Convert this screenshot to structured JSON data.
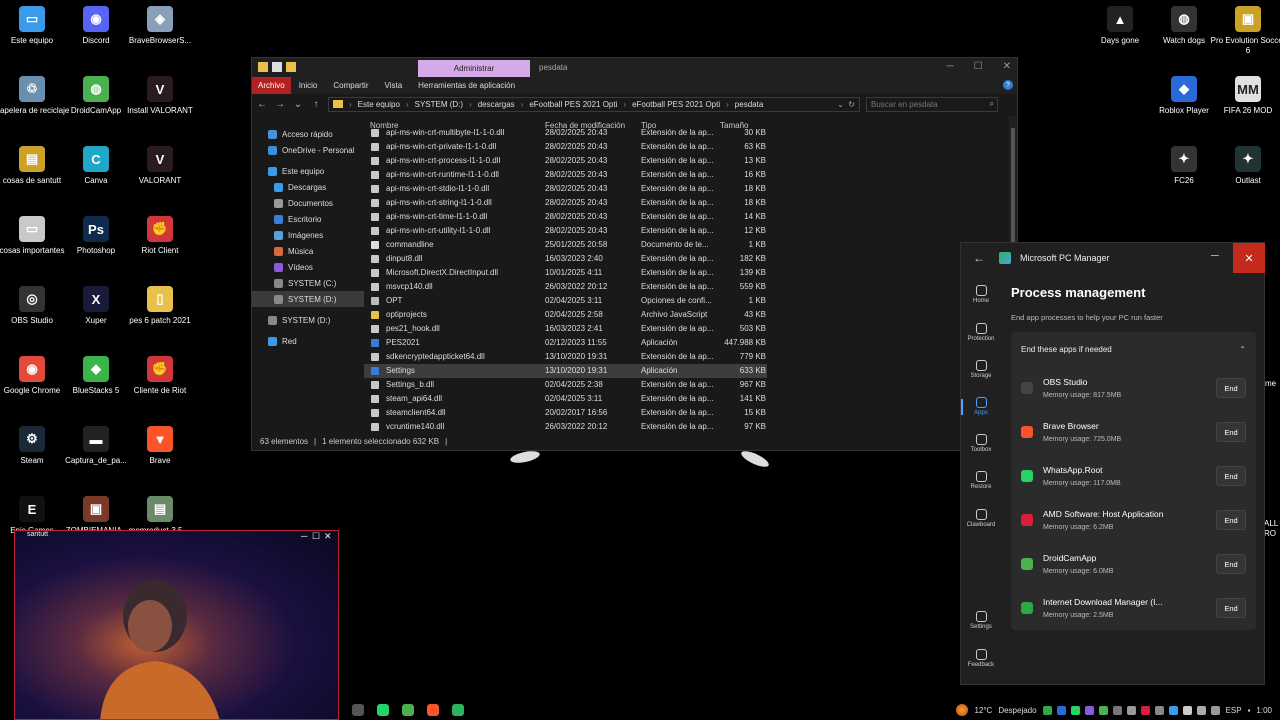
{
  "desktop_left": [
    {
      "label": "Este equipo",
      "color": "#3c9be8",
      "glyph": "▭"
    },
    {
      "label": "Discord",
      "color": "#5865f2",
      "glyph": "◉"
    },
    {
      "label": "BraveBrowserS...",
      "color": "#8aa0b8",
      "glyph": "◈"
    },
    {
      "label": "Papelera de reciclaje",
      "color": "#6a8fb0",
      "glyph": "♲"
    },
    {
      "label": "DroidCamApp",
      "color": "#4caf50",
      "glyph": "◍"
    },
    {
      "label": "Install VALORANT",
      "color": "#2a1a22",
      "glyph": "V"
    },
    {
      "label": "cosas de santutt",
      "color": "#c9a227",
      "glyph": "▤"
    },
    {
      "label": "Canva",
      "color": "#20a7c7",
      "glyph": "C"
    },
    {
      "label": "VALORANT",
      "color": "#2a1a22",
      "glyph": "V"
    },
    {
      "label": "cosas importantes",
      "color": "#c9c9c9",
      "glyph": "▭"
    },
    {
      "label": "Photoshop",
      "color": "#0f2a4a",
      "glyph": "Ps"
    },
    {
      "label": "Riot Client",
      "color": "#d13639",
      "glyph": "✊"
    },
    {
      "label": "OBS Studio",
      "color": "#333",
      "glyph": "◎"
    },
    {
      "label": "Xuper",
      "color": "#1a1a3a",
      "glyph": "X"
    },
    {
      "label": "pes 6 patch 2021",
      "color": "#e8c04a",
      "glyph": "▯"
    },
    {
      "label": "Google Chrome",
      "color": "#e24a3a",
      "glyph": "◉"
    },
    {
      "label": "BlueStacks 5",
      "color": "#3ab54a",
      "glyph": "◆"
    },
    {
      "label": "Cliente de Riot",
      "color": "#d13639",
      "glyph": "✊"
    },
    {
      "label": "Steam",
      "color": "#1b2838",
      "glyph": "⚙"
    },
    {
      "label": "Captura_de_pa...",
      "color": "#222",
      "glyph": "▬"
    },
    {
      "label": "Brave",
      "color": "#fb542b",
      "glyph": "▼"
    },
    {
      "label": "Epic Games",
      "color": "#111",
      "glyph": "E"
    },
    {
      "label": "ZOMBIEMANIA -",
      "color": "#7a3a2a",
      "glyph": "▣"
    },
    {
      "label": "memreduct-3.5....",
      "color": "#6a8a6a",
      "glyph": "▤"
    }
  ],
  "desktop_right": [
    {
      "label": "Days gone",
      "color": "#222",
      "glyph": "▲"
    },
    {
      "label": "Watch dogs",
      "color": "#333",
      "glyph": "◍"
    },
    {
      "label": "Pro Evolution Soccer 6",
      "color": "#c9a227",
      "glyph": "▣"
    },
    {
      "label": "Roblox Player",
      "color": "#2a6ad8",
      "glyph": "◆"
    },
    {
      "label": "FIFA 26 MOD",
      "color": "#e0e0e0",
      "glyph": "MM"
    },
    {
      "label": "FC26",
      "color": "#333",
      "glyph": "✦"
    },
    {
      "label": "Outlast",
      "color": "#233",
      "glyph": "✦"
    }
  ],
  "explorer": {
    "admin_tab": "Administrar",
    "folder_name": "pesdata",
    "ribbon": {
      "file": "Archivo",
      "tabs": [
        "Inicio",
        "Compartir",
        "Vista",
        "Herramientas de aplicación"
      ]
    },
    "breadcrumb": [
      "Este equipo",
      "SYSTEM (D:)",
      "descargas",
      "eFootball PES 2021 Opti",
      "eFootball PES 2021 Opti",
      "pesdata"
    ],
    "search_placeholder": "Buscar en pesdata",
    "nav": [
      {
        "label": "Acceso rápido",
        "color": "#4a90d9",
        "indent": 0
      },
      {
        "label": "OneDrive - Personal",
        "color": "#3a8fd8",
        "indent": 0
      },
      {
        "label": "Este equipo",
        "color": "#3c9be8",
        "indent": 0
      },
      {
        "label": "Descargas",
        "color": "#3c9be8",
        "indent": 1
      },
      {
        "label": "Documentos",
        "color": "#999",
        "indent": 1
      },
      {
        "label": "Escritorio",
        "color": "#3c7bd8",
        "indent": 1
      },
      {
        "label": "Imágenes",
        "color": "#5aa0d8",
        "indent": 1
      },
      {
        "label": "Música",
        "color": "#d86a3a",
        "indent": 1
      },
      {
        "label": "Vídeos",
        "color": "#8a5ad8",
        "indent": 1
      },
      {
        "label": "SYSTEM (C:)",
        "color": "#888",
        "indent": 1
      },
      {
        "label": "SYSTEM (D:)",
        "color": "#888",
        "indent": 1,
        "selected": true
      },
      {
        "label": "SYSTEM (D:)",
        "color": "#888",
        "indent": 0
      },
      {
        "label": "Red",
        "color": "#3c9be8",
        "indent": 0
      }
    ],
    "columns": {
      "name": "Nombre",
      "date": "Fecha de modificación",
      "type": "Tipo",
      "size": "Tamaño"
    },
    "files": [
      {
        "name": "api-ms-win-crt-multibyte-l1-1-0.dll",
        "date": "28/02/2025 20:43",
        "type": "Extensión de la ap...",
        "size": "30 KB"
      },
      {
        "name": "api-ms-win-crt-private-l1-1-0.dll",
        "date": "28/02/2025 20:43",
        "type": "Extensión de la ap...",
        "size": "63 KB"
      },
      {
        "name": "api-ms-win-crt-process-l1-1-0.dll",
        "date": "28/02/2025 20:43",
        "type": "Extensión de la ap...",
        "size": "13 KB"
      },
      {
        "name": "api-ms-win-crt-runtime-l1-1-0.dll",
        "date": "28/02/2025 20:43",
        "type": "Extensión de la ap...",
        "size": "16 KB"
      },
      {
        "name": "api-ms-win-crt-stdio-l1-1-0.dll",
        "date": "28/02/2025 20:43",
        "type": "Extensión de la ap...",
        "size": "18 KB"
      },
      {
        "name": "api-ms-win-crt-string-l1-1-0.dll",
        "date": "28/02/2025 20:43",
        "type": "Extensión de la ap...",
        "size": "18 KB"
      },
      {
        "name": "api-ms-win-crt-time-l1-1-0.dll",
        "date": "28/02/2025 20:43",
        "type": "Extensión de la ap...",
        "size": "14 KB"
      },
      {
        "name": "api-ms-win-crt-utility-l1-1-0.dll",
        "date": "28/02/2025 20:43",
        "type": "Extensión de la ap...",
        "size": "12 KB"
      },
      {
        "name": "commandline",
        "date": "25/01/2025 20:58",
        "type": "Documento de te...",
        "size": "1 KB"
      },
      {
        "name": "dinput8.dll",
        "date": "16/03/2023 2:40",
        "type": "Extensión de la ap...",
        "size": "182 KB"
      },
      {
        "name": "Microsoft.DirectX.DirectInput.dll",
        "date": "10/01/2025 4:11",
        "type": "Extensión de la ap...",
        "size": "139 KB"
      },
      {
        "name": "msvcp140.dll",
        "date": "26/03/2022 20:12",
        "type": "Extensión de la ap...",
        "size": "559 KB"
      },
      {
        "name": "OPT",
        "date": "02/04/2025 3:11",
        "type": "Opciones de confi...",
        "size": "1 KB"
      },
      {
        "name": "optiprojects",
        "date": "02/04/2025 2:58",
        "type": "Archivo JavaScript",
        "size": "43 KB"
      },
      {
        "name": "pes21_hook.dll",
        "date": "16/03/2023 2:41",
        "type": "Extensión de la ap...",
        "size": "503 KB"
      },
      {
        "name": "PES2021",
        "date": "02/12/2023 11:55",
        "type": "Aplicación",
        "size": "447.988 KB"
      },
      {
        "name": "sdkencryptedappticket64.dll",
        "date": "13/10/2020 19:31",
        "type": "Extensión de la ap...",
        "size": "779 KB"
      },
      {
        "name": "Settings",
        "date": "13/10/2020 19:31",
        "type": "Aplicación",
        "size": "633 KB",
        "selected": true
      },
      {
        "name": "Settings_b.dll",
        "date": "02/04/2025 2:38",
        "type": "Extensión de la ap...",
        "size": "967 KB"
      },
      {
        "name": "steam_api64.dll",
        "date": "02/04/2025 3:11",
        "type": "Extensión de la ap...",
        "size": "141 KB"
      },
      {
        "name": "steamclient64.dll",
        "date": "20/02/2017 16:56",
        "type": "Extensión de la ap...",
        "size": "15 KB"
      },
      {
        "name": "vcruntime140.dll",
        "date": "26/03/2022 20:12",
        "type": "Extensión de la ap...",
        "size": "97 KB"
      }
    ],
    "status": {
      "count": "63 elementos",
      "selected": "1 elemento seleccionado  632 KB"
    }
  },
  "pcmanager": {
    "title": "Microsoft PC Manager",
    "heading": "Process management",
    "subtitle": "End app processes to help your PC run faster",
    "section": "End these apps if needed",
    "end_label": "End",
    "sidebar": [
      {
        "label": "Home",
        "active": false
      },
      {
        "label": "Protection",
        "active": false
      },
      {
        "label": "Storage",
        "active": false
      },
      {
        "label": "Apps",
        "active": true
      },
      {
        "label": "Toolbox",
        "active": false
      },
      {
        "label": "Restore",
        "active": false
      },
      {
        "label": "Clawboard",
        "active": false
      },
      {
        "label": "Settings",
        "active": false
      },
      {
        "label": "Feedback",
        "active": false
      }
    ],
    "apps": [
      {
        "name": "OBS Studio",
        "mem": "Memory usage: 817.5MB",
        "color": "#444"
      },
      {
        "name": "Brave Browser",
        "mem": "Memory usage: 725.0MB",
        "color": "#fb542b"
      },
      {
        "name": "WhatsApp.Root",
        "mem": "Memory usage: 117.0MB",
        "color": "#25d366"
      },
      {
        "name": "AMD Software: Host Application",
        "mem": "Memory usage: 6.2MB",
        "color": "#d81e3a"
      },
      {
        "name": "DroidCamApp",
        "mem": "Memory usage: 6.0MB",
        "color": "#4caf50"
      },
      {
        "name": "Internet Download Manager (I...",
        "mem": "Memory usage: 2.5MB",
        "color": "#2ea84a"
      }
    ]
  },
  "webcam": {
    "label": "santutt"
  },
  "taskbar": {
    "apps": [
      {
        "name": "obs",
        "color": "#555"
      },
      {
        "name": "whatsapp",
        "color": "#25d366"
      },
      {
        "name": "droidcam",
        "color": "#4caf50"
      },
      {
        "name": "brave",
        "color": "#fb542b"
      },
      {
        "name": "pc-manager",
        "color": "#2db35d"
      }
    ],
    "weather_temp": "12°C",
    "weather_text": "Despejado",
    "lang": "ESP",
    "time": "1:00",
    "tray_colors": [
      "#2ea84a",
      "#2a6ad8",
      "#25d366",
      "#8a5ad8",
      "#4caf50",
      "#777",
      "#999",
      "#d81e3a",
      "#888",
      "#3c9be8",
      "#ccc",
      "#aaa",
      "#999"
    ]
  },
  "partial_labels": {
    "right_edge_1": "me",
    "right_edge_2": "ALL",
    "right_edge_3": "RO"
  }
}
